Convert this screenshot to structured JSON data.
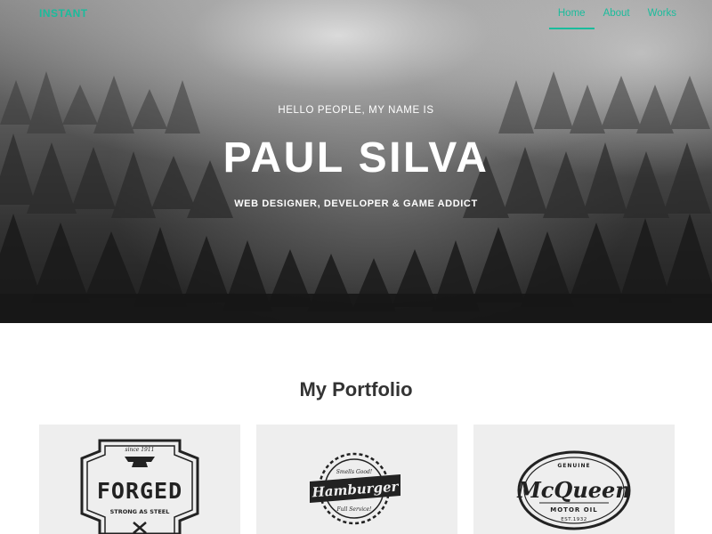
{
  "navbar": {
    "brand": "INSTANT",
    "items": [
      {
        "label": "Home",
        "active": true
      },
      {
        "label": "About",
        "active": false
      },
      {
        "label": "Works",
        "active": false
      }
    ]
  },
  "hero": {
    "greeting": "HELLO PEOPLE, MY NAME IS",
    "name": "PAUL SILVA",
    "tagline": "WEB DESIGNER, DEVELOPER & GAME ADDICT"
  },
  "portfolio": {
    "title": "My Portfolio",
    "items": [
      {
        "logo_title": "FORGED",
        "logo_top": "since 1911",
        "logo_sub": "STRONG AS STEEL"
      },
      {
        "logo_title": "Hamburger",
        "logo_top": "Smells Good!",
        "logo_sub": "Full Service!"
      },
      {
        "logo_title": "McQueen",
        "logo_top": "GENUINE",
        "logo_sub": "MOTOR OIL",
        "logo_est": "EST.1932"
      }
    ]
  },
  "colors": {
    "accent": "#1abc9c",
    "heading": "#333333",
    "card_bg": "#eeeeee"
  }
}
